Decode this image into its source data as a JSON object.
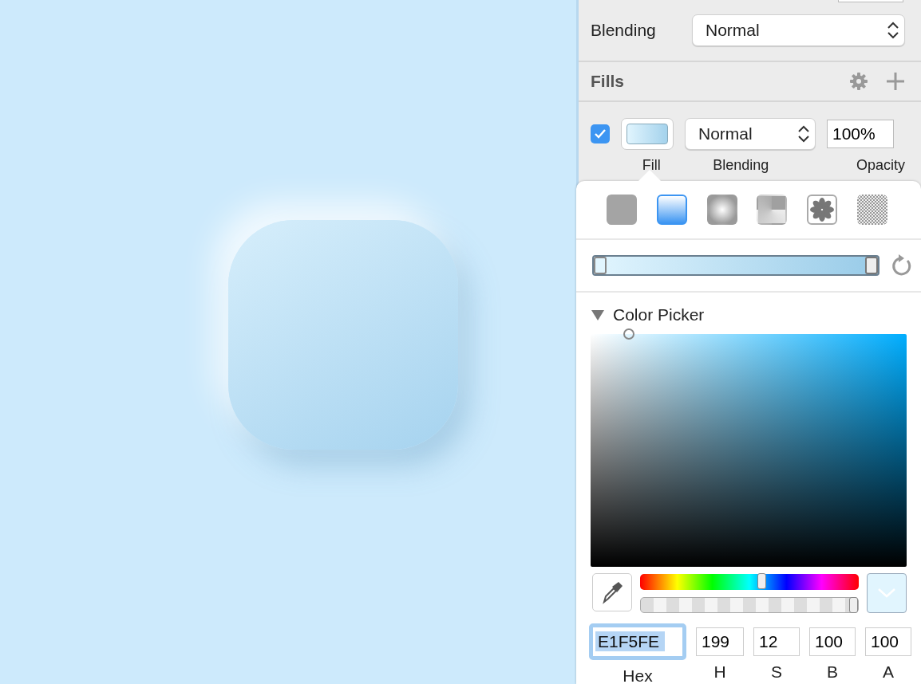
{
  "layer": {
    "blending_label": "Blending",
    "blending_value": "Normal"
  },
  "fills": {
    "title": "Fills",
    "items": [
      {
        "checked": true,
        "blending": "Normal",
        "opacity": "100%"
      }
    ],
    "column_labels": [
      "Fill",
      "Blending",
      "Opacity"
    ]
  },
  "fill_popover": {
    "fill_types": [
      {
        "kind": "solid",
        "selected": false
      },
      {
        "kind": "linear",
        "selected": true
      },
      {
        "kind": "radial",
        "selected": false
      },
      {
        "kind": "angular",
        "selected": false
      },
      {
        "kind": "pattern",
        "selected": false
      },
      {
        "kind": "noise",
        "selected": false
      }
    ],
    "gradient_stops": [
      {
        "level": 0,
        "selected": true
      },
      {
        "level": 1,
        "selected": false
      }
    ],
    "color_picker": {
      "title": "Color Picker",
      "expanded": true,
      "hue": {
        "level": 0.553
      },
      "alpha": {
        "level": 1
      },
      "fields": [
        {
          "label": "Hex",
          "value": "E1F5FE",
          "selected": true
        },
        {
          "label": "H",
          "value": "199",
          "selected": false
        },
        {
          "label": "S",
          "value": "12",
          "selected": false
        },
        {
          "label": "B",
          "value": "100",
          "selected": false
        },
        {
          "label": "A",
          "value": "100",
          "selected": false
        }
      ]
    }
  }
}
